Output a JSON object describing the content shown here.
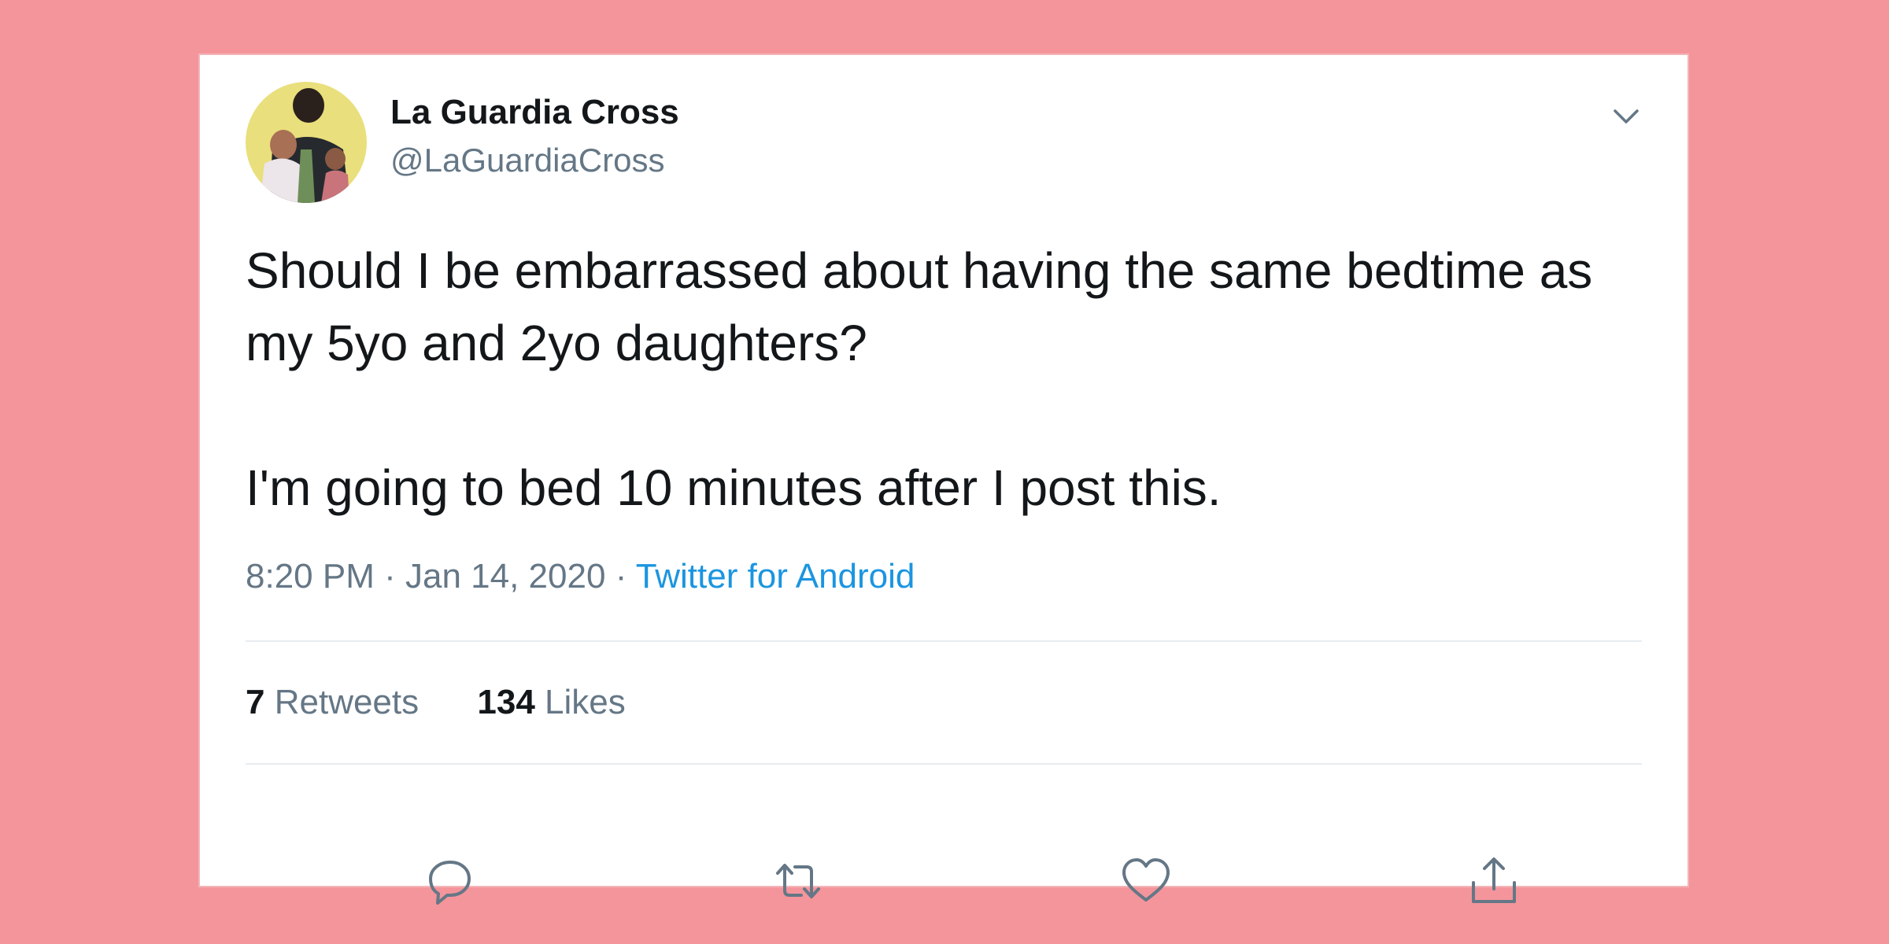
{
  "tweet": {
    "display_name": "La Guardia Cross",
    "handle": "@LaGuardiaCross",
    "text_line1": "Should I be embarrassed about having the same bedtime as my 5yo and 2yo daughters?",
    "text_line2": "I'm going to bed 10 minutes after I post this.",
    "time": "8:20 PM",
    "date": "Jan 14, 2020",
    "separator": "·",
    "source": "Twitter for Android"
  },
  "stats": {
    "retweets_count": "7",
    "retweets_label": "Retweets",
    "likes_count": "134",
    "likes_label": "Likes"
  },
  "icons": {
    "menu": "chevron-down-icon",
    "reply": "reply-icon",
    "retweet": "retweet-icon",
    "like": "heart-icon",
    "share": "share-icon"
  },
  "colors": {
    "background": "#f4959b",
    "card": "#ffffff",
    "link": "#1b95e0",
    "muted": "#657786",
    "text": "#14171a"
  }
}
